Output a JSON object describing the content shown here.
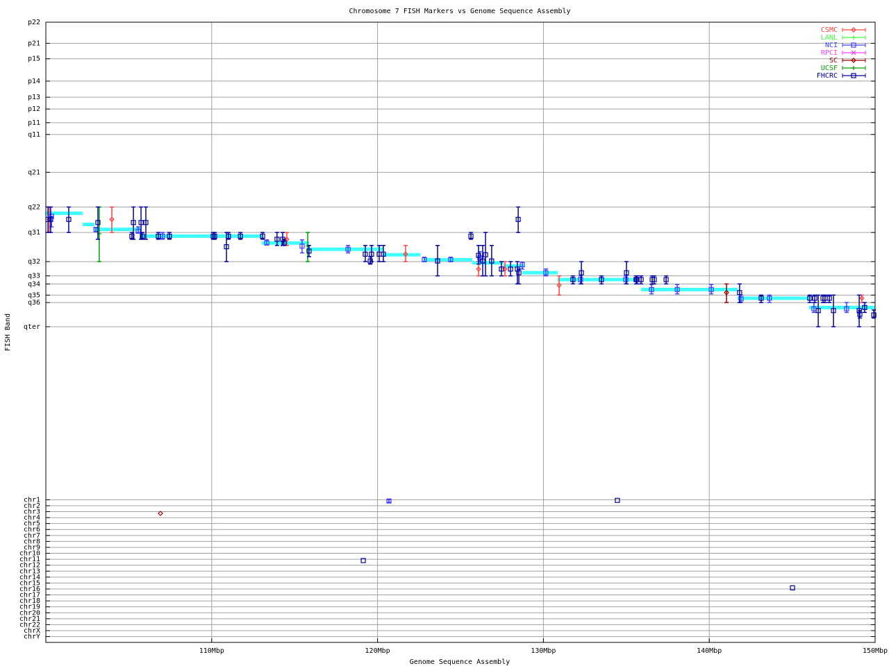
{
  "chart_data": {
    "type": "scatter",
    "title": "Chromosome 7 FISH Markers vs Genome Sequence Assembly",
    "xlabel": "Genome Sequence Assembly",
    "ylabel": "FISH Band",
    "xlim": [
      100,
      150
    ],
    "ylim": [
      0,
      100
    ],
    "grid": true,
    "legend_position": "top-right",
    "x_ticks": [
      {
        "label": "110Mbp",
        "value": 110
      },
      {
        "label": "120Mbp",
        "value": 120
      },
      {
        "label": "130Mbp",
        "value": 130
      },
      {
        "label": "140Mbp",
        "value": 140
      },
      {
        "label": "150Mbp",
        "value": 150
      }
    ],
    "band_ticks": [
      {
        "label": "p22",
        "value": 0
      },
      {
        "label": "p21",
        "value": 3.4
      },
      {
        "label": "p15",
        "value": 5.9
      },
      {
        "label": "p14",
        "value": 9.5
      },
      {
        "label": "p13",
        "value": 12.1
      },
      {
        "label": "p12",
        "value": 14.0
      },
      {
        "label": "p11",
        "value": 16.2
      },
      {
        "label": "q11",
        "value": 18.1
      },
      {
        "label": "q21",
        "value": 24.2
      },
      {
        "label": "q22",
        "value": 29.8
      },
      {
        "label": "q31",
        "value": 33.9
      },
      {
        "label": "q32",
        "value": 38.6
      },
      {
        "label": "q33",
        "value": 40.9
      },
      {
        "label": "q34",
        "value": 42.2
      },
      {
        "label": "q35",
        "value": 44.0
      },
      {
        "label": "q36",
        "value": 45.2
      },
      {
        "label": "qter",
        "value": 49.1
      }
    ],
    "chr_ticks": {
      "start": 77.0,
      "step": 0.959,
      "labels": [
        "chr1",
        "chr2",
        "chr3",
        "chr4",
        "chr5",
        "chr6",
        "chr7",
        "chr8",
        "chr9",
        "chr10",
        "chr11",
        "chr12",
        "chr13",
        "chr14",
        "chr15",
        "chr16",
        "chr17",
        "chr18",
        "chr19",
        "chr20",
        "chr21",
        "chr22",
        "chrX",
        "chrY"
      ]
    },
    "assembly_color": "#40ffff",
    "assembly_segments": [
      [
        100.0,
        102.22,
        30.8
      ],
      [
        102.22,
        102.93,
        32.6
      ],
      [
        102.93,
        105.7,
        33.4
      ],
      [
        105.7,
        113.02,
        34.5
      ],
      [
        113.02,
        115.87,
        35.6
      ],
      [
        115.87,
        120.35,
        36.6
      ],
      [
        120.35,
        122.57,
        37.5
      ],
      [
        122.78,
        125.71,
        38.3
      ],
      [
        125.71,
        127.6,
        38.8
      ],
      [
        127.6,
        128.85,
        39.3
      ],
      [
        128.73,
        130.86,
        40.4
      ],
      [
        130.86,
        135.55,
        41.5
      ],
      [
        135.89,
        141.71,
        43.1
      ],
      [
        141.71,
        146.02,
        44.5
      ],
      [
        146.02,
        150.0,
        46.0
      ]
    ],
    "series": [
      {
        "name": "CSMC",
        "color": "#ff4040",
        "marker": "diamond",
        "points": [
          [
            100.21,
            31.8,
            29.8,
            33.9
          ],
          [
            103.98,
            31.8,
            29.8,
            33.9
          ],
          [
            114.53,
            35.0,
            33.9,
            36.0
          ],
          [
            121.69,
            37.4,
            36.0,
            38.6
          ],
          [
            126.09,
            39.8,
            38.6,
            40.9
          ],
          [
            127.68,
            39.8,
            38.6,
            40.9
          ],
          [
            130.95,
            42.4,
            40.9,
            44.0
          ],
          [
            149.2,
            44.5,
            44.0,
            45.2
          ]
        ]
      },
      {
        "name": "LANL",
        "color": "#40ff40",
        "marker": "plus",
        "points": []
      },
      {
        "name": "NCI",
        "color": "#4040ff",
        "marker": "box",
        "points": [
          [
            100.34,
            31.3,
            31.3,
            33.0
          ],
          [
            103.02,
            33.4,
            33.1,
            33.8
          ],
          [
            105.57,
            33.7,
            33.0,
            33.9
          ],
          [
            107.04,
            34.5,
            33.9,
            35.0
          ],
          [
            113.32,
            35.6,
            35.1,
            35.9
          ],
          [
            115.45,
            36.1,
            35.1,
            37.2
          ],
          [
            118.22,
            36.6,
            36.0,
            37.2
          ],
          [
            122.82,
            38.3,
            37.9,
            38.6
          ],
          [
            124.41,
            38.3,
            37.9,
            38.6
          ],
          [
            126.17,
            38.0,
            37.0,
            38.6
          ],
          [
            128.73,
            39.1,
            38.7,
            39.8
          ],
          [
            130.15,
            40.4,
            39.8,
            40.9
          ],
          [
            132.24,
            41.5,
            40.9,
            42.2
          ],
          [
            134.97,
            41.5,
            40.9,
            42.2
          ],
          [
            136.52,
            43.1,
            42.3,
            43.8
          ],
          [
            138.07,
            43.1,
            42.3,
            43.8
          ],
          [
            140.12,
            43.1,
            42.3,
            43.8
          ],
          [
            141.92,
            44.6,
            44.0,
            45.2
          ],
          [
            143.63,
            44.5,
            44.0,
            45.2
          ],
          [
            146.31,
            46.2,
            45.2,
            46.8
          ],
          [
            148.28,
            46.2,
            45.2,
            46.8
          ],
          [
            120.69,
            77.2,
            77.0,
            77.4
          ]
        ]
      },
      {
        "name": "RPCI",
        "color": "#ff40ff",
        "marker": "cross",
        "points": []
      },
      {
        "name": "SC",
        "color": "#a00000",
        "marker": "diamond",
        "points": [
          [
            141.04,
            43.6,
            42.2,
            45.2
          ],
          [
            106.91,
            79.2,
            79.2,
            79.2
          ]
        ]
      },
      {
        "name": "UCSF",
        "color": "#00a000",
        "marker": "plus",
        "points": [
          [
            103.22,
            34.1,
            29.8,
            38.6
          ],
          [
            115.79,
            36.1,
            33.9,
            38.6
          ]
        ]
      },
      {
        "name": "FHCRC",
        "color": "#0000a0",
        "marker": "box",
        "points": [
          [
            100.13,
            31.8,
            29.8,
            33.9
          ],
          [
            100.29,
            31.8,
            29.8,
            33.9
          ],
          [
            101.38,
            31.8,
            29.8,
            33.9
          ],
          [
            103.14,
            32.3,
            29.8,
            35.0
          ],
          [
            105.19,
            34.5,
            33.9,
            35.0
          ],
          [
            105.28,
            32.3,
            29.8,
            35.0
          ],
          [
            105.74,
            32.3,
            29.8,
            35.0
          ],
          [
            105.82,
            34.5,
            33.9,
            35.0
          ],
          [
            106.03,
            32.3,
            29.8,
            35.0
          ],
          [
            106.78,
            34.5,
            33.9,
            35.0
          ],
          [
            107.45,
            34.5,
            33.9,
            35.0
          ],
          [
            110.09,
            34.5,
            33.9,
            35.0
          ],
          [
            110.18,
            34.5,
            33.9,
            35.0
          ],
          [
            110.89,
            36.2,
            33.9,
            38.6
          ],
          [
            111.01,
            34.5,
            33.9,
            35.0
          ],
          [
            111.73,
            34.5,
            33.9,
            35.0
          ],
          [
            113.07,
            34.5,
            33.9,
            35.0
          ],
          [
            113.94,
            35.0,
            33.9,
            36.0
          ],
          [
            114.28,
            35.0,
            33.9,
            36.0
          ],
          [
            114.36,
            35.6,
            35.0,
            36.0
          ],
          [
            115.87,
            36.9,
            36.0,
            37.8
          ],
          [
            119.26,
            37.4,
            36.0,
            38.6
          ],
          [
            119.56,
            38.5,
            37.8,
            39.0
          ],
          [
            119.64,
            37.4,
            36.0,
            38.6
          ],
          [
            120.1,
            37.4,
            36.0,
            38.6
          ],
          [
            120.35,
            37.4,
            36.0,
            38.6
          ],
          [
            123.62,
            38.5,
            36.0,
            40.9
          ],
          [
            125.63,
            34.5,
            33.9,
            35.0
          ],
          [
            126.09,
            37.6,
            36.0,
            39.0
          ],
          [
            126.34,
            38.5,
            36.0,
            40.9
          ],
          [
            126.51,
            37.5,
            33.9,
            40.9
          ],
          [
            126.88,
            38.5,
            36.0,
            40.9
          ],
          [
            127.47,
            39.8,
            38.6,
            40.9
          ],
          [
            128.02,
            39.8,
            38.6,
            40.9
          ],
          [
            128.43,
            39.8,
            38.6,
            42.2
          ],
          [
            128.52,
            40.4,
            39.8,
            42.2
          ],
          [
            128.48,
            31.8,
            29.8,
            33.9
          ],
          [
            131.78,
            41.5,
            40.9,
            42.2
          ],
          [
            132.29,
            40.4,
            38.6,
            42.2
          ],
          [
            133.5,
            41.5,
            40.9,
            42.2
          ],
          [
            135.01,
            40.4,
            38.6,
            42.2
          ],
          [
            135.59,
            41.5,
            40.9,
            42.2
          ],
          [
            135.64,
            41.5,
            40.9,
            42.2
          ],
          [
            135.89,
            41.5,
            40.9,
            42.2
          ],
          [
            136.56,
            41.5,
            40.9,
            42.2
          ],
          [
            136.68,
            41.5,
            40.9,
            42.2
          ],
          [
            137.4,
            41.5,
            40.9,
            42.2
          ],
          [
            141.83,
            43.6,
            42.2,
            45.2
          ],
          [
            143.13,
            44.5,
            44.0,
            45.2
          ],
          [
            146.06,
            44.5,
            44.0,
            45.2
          ],
          [
            146.36,
            44.5,
            44.0,
            45.2
          ],
          [
            146.57,
            46.5,
            44.0,
            49.1
          ],
          [
            146.86,
            44.5,
            44.0,
            45.2
          ],
          [
            146.98,
            44.5,
            44.0,
            45.2
          ],
          [
            147.24,
            44.5,
            44.0,
            45.2
          ],
          [
            147.49,
            46.5,
            44.0,
            49.1
          ],
          [
            149.04,
            46.5,
            44.0,
            49.1
          ],
          [
            149.08,
            47.1,
            46.5,
            47.7
          ],
          [
            149.37,
            46.0,
            45.2,
            46.8
          ],
          [
            149.92,
            47.2,
            46.4,
            47.7
          ],
          [
            134.46,
            77.1,
            77.1,
            77.1
          ],
          [
            119.14,
            86.8,
            86.8,
            86.8
          ],
          [
            145.02,
            91.2,
            91.2,
            91.2
          ]
        ]
      }
    ]
  }
}
